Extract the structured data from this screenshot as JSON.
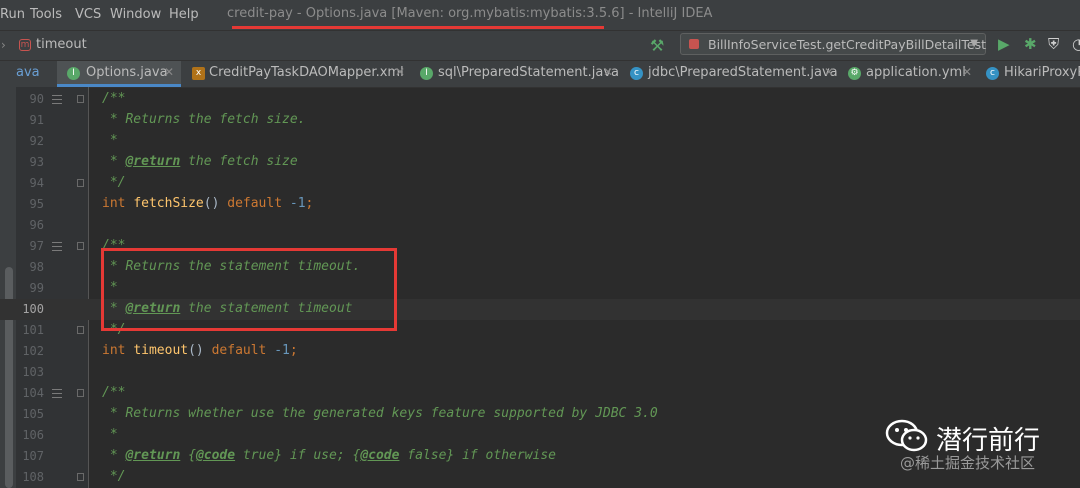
{
  "menu": [
    "Run",
    "Tools",
    "VCS",
    "Window",
    "Help"
  ],
  "window_title": "credit-pay - Options.java [Maven: org.mybatis:mybatis:3.5.6] - IntelliJ IDEA",
  "navbar": {
    "breadcrumb_label": "timeout",
    "run_config": "BillInfoServiceTest.getCreditPayBillDetailTest"
  },
  "tabs": [
    {
      "label": "ava",
      "icon": "java-class-icon"
    },
    {
      "label": "Options.java",
      "icon": "interface-icon",
      "active": true
    },
    {
      "label": "CreditPayTaskDAOMapper.xml",
      "icon": "xml-file-icon"
    },
    {
      "label": "sql\\PreparedStatement.java",
      "icon": "interface-icon"
    },
    {
      "label": "jdbc\\PreparedStatement.java",
      "icon": "class-icon"
    },
    {
      "label": "application.yml",
      "icon": "yaml-file-icon"
    },
    {
      "label": "HikariProxyPr",
      "icon": "class-icon"
    }
  ],
  "code_lines": [
    {
      "no": "90",
      "tokens": [
        [
          "doc",
          "/**"
        ]
      ]
    },
    {
      "no": "91",
      "tokens": [
        [
          "doc",
          " * Returns the fetch size."
        ]
      ]
    },
    {
      "no": "92",
      "tokens": [
        [
          "doc",
          " *"
        ]
      ]
    },
    {
      "no": "93",
      "tokens": [
        [
          "doc",
          " * "
        ],
        [
          "doc-tag",
          "@return"
        ],
        [
          "doc",
          " the fetch size"
        ]
      ]
    },
    {
      "no": "94",
      "tokens": [
        [
          "doc",
          " */"
        ]
      ]
    },
    {
      "no": "95",
      "tokens": [
        [
          "kw",
          "int "
        ],
        [
          "method",
          "fetchSize"
        ],
        [
          "plain",
          "() "
        ],
        [
          "kw",
          "default "
        ],
        [
          "num",
          "-1"
        ],
        [
          "kw",
          ";"
        ]
      ]
    },
    {
      "no": "96",
      "tokens": []
    },
    {
      "no": "97",
      "tokens": [
        [
          "doc",
          "/**"
        ]
      ]
    },
    {
      "no": "98",
      "tokens": [
        [
          "doc",
          " * Returns the statement timeout."
        ]
      ]
    },
    {
      "no": "99",
      "tokens": [
        [
          "doc",
          " *"
        ]
      ]
    },
    {
      "no": "100",
      "tokens": [
        [
          "doc",
          " * "
        ],
        [
          "doc-tag",
          "@return"
        ],
        [
          "doc",
          " the statement timeout"
        ]
      ]
    },
    {
      "no": "101",
      "tokens": [
        [
          "doc",
          " */"
        ]
      ]
    },
    {
      "no": "102",
      "tokens": [
        [
          "kw",
          "int "
        ],
        [
          "method",
          "timeout"
        ],
        [
          "plain",
          "() "
        ],
        [
          "kw",
          "default "
        ],
        [
          "num",
          "-1"
        ],
        [
          "kw",
          ";"
        ]
      ]
    },
    {
      "no": "103",
      "tokens": []
    },
    {
      "no": "104",
      "tokens": [
        [
          "doc",
          "/**"
        ]
      ]
    },
    {
      "no": "105",
      "tokens": [
        [
          "doc",
          " * Returns whether use the generated keys feature supported by JDBC 3.0"
        ]
      ]
    },
    {
      "no": "106",
      "tokens": [
        [
          "doc",
          " *"
        ]
      ]
    },
    {
      "no": "107",
      "tokens": [
        [
          "doc",
          " * "
        ],
        [
          "doc-tag",
          "@return"
        ],
        [
          "doc",
          " {"
        ],
        [
          "doc-tag",
          "@code"
        ],
        [
          "doc",
          " true} if use; {"
        ],
        [
          "doc-tag",
          "@code"
        ],
        [
          "doc",
          " false} if otherwise"
        ]
      ]
    },
    {
      "no": "108",
      "tokens": [
        [
          "doc",
          " */"
        ]
      ]
    }
  ],
  "current_line": "100",
  "watermark": {
    "name": "潜行前行",
    "sub": "@稀土掘金技术社区"
  }
}
